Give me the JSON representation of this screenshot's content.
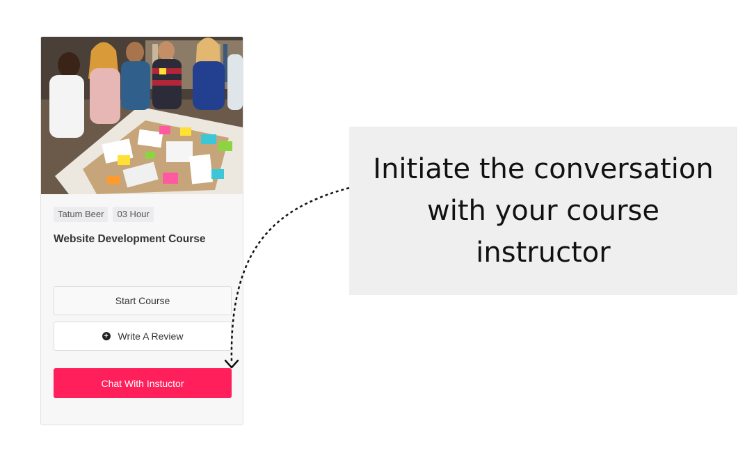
{
  "course_card": {
    "image_alt": "students collaborating around a table with sticky notes",
    "tags": [
      "Tatum Beer",
      "03 Hour"
    ],
    "title": "Website Development Course",
    "start_button_label": "Start Course",
    "review_button_label": "Write A Review",
    "chat_button_label": "Chat With Instuctor"
  },
  "callout": {
    "text": "Initiate the conversation with your course instructor"
  },
  "colors": {
    "accent": "#ff1f5a",
    "callout_bg": "#efefef",
    "card_bg": "#f7f7f8"
  },
  "icons": {
    "review": "plus-circle-icon",
    "arrow": "dashed-arrow-icon"
  }
}
